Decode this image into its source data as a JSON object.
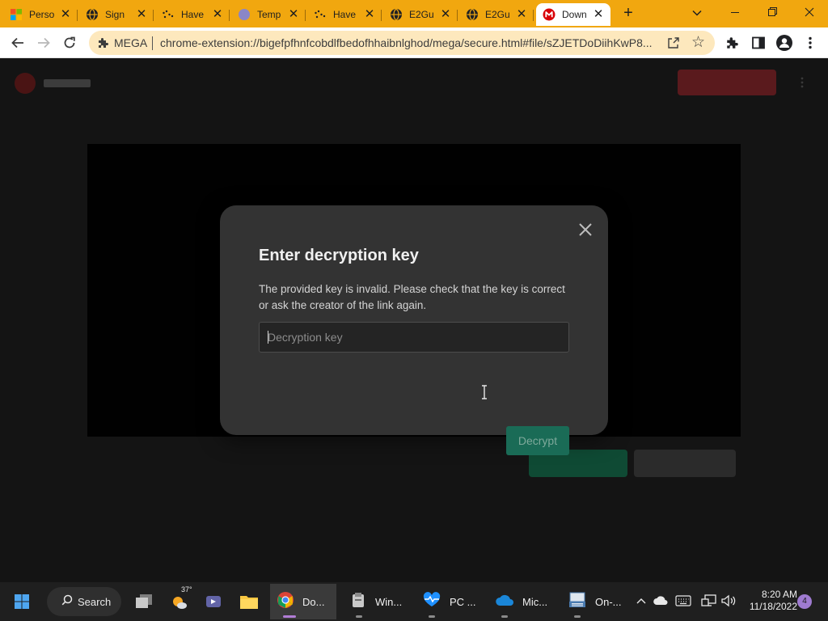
{
  "browser": {
    "tabs": [
      {
        "title": "Perso",
        "favicon": "microsoft-icon"
      },
      {
        "title": "Sign",
        "favicon": "globe-icon"
      },
      {
        "title": "Have",
        "favicon": "dotted-icon"
      },
      {
        "title": "Temp",
        "favicon": "circle-icon"
      },
      {
        "title": "Have",
        "favicon": "dotted-icon"
      },
      {
        "title": "E2Gu",
        "favicon": "globe-icon"
      },
      {
        "title": "E2Gu",
        "favicon": "globe-icon"
      },
      {
        "title": "Down",
        "favicon": "mega-icon",
        "active": true
      }
    ],
    "new_tab_label": "+",
    "close_glyph": "✕",
    "address": {
      "label": "MEGA",
      "url": "chrome-extension://bigefpfhnfcobdlfbedofhhaibnlghod/mega/secure.html#file/sZJETDoDiihKwP8..."
    },
    "colors": {
      "tab_strip": "#f1a70f",
      "omnibox": "#fde8bd",
      "mega_red": "#d90007"
    }
  },
  "dialog": {
    "title": "Enter decryption key",
    "message": "The provided key is invalid. Please check that the key is correct or ask the creator of the link again.",
    "input_placeholder": "Decryption key",
    "input_value": "",
    "submit_label": "Decrypt",
    "close_glyph": "✕",
    "colors": {
      "background": "#333333",
      "button": "#1a6b56"
    }
  },
  "taskbar": {
    "search_label": "Search",
    "weather_temp": "37°",
    "apps": [
      {
        "label": "Do...",
        "icon": "chrome-icon",
        "active": true
      },
      {
        "label": "Win...",
        "icon": "installer-icon"
      },
      {
        "label": "PC ...",
        "icon": "pc-health-icon"
      },
      {
        "label": "Mic...",
        "icon": "onedrive-icon"
      },
      {
        "label": "On-...",
        "icon": "onscreen-keyboard-icon"
      }
    ],
    "clock": {
      "time": "8:20 AM",
      "date": "11/18/2022"
    },
    "notification_count": "4"
  }
}
